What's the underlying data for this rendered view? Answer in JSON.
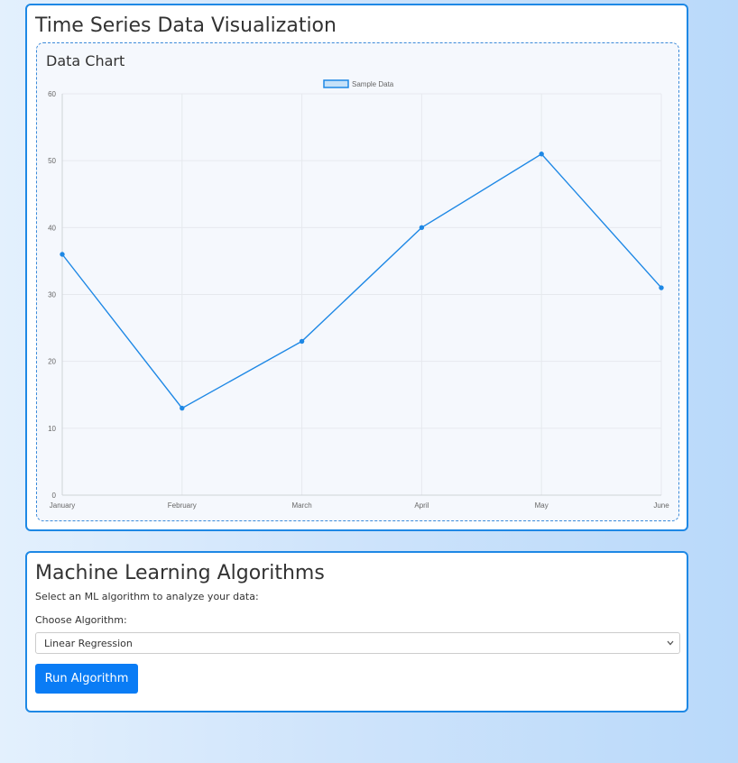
{
  "viz": {
    "title": "Time Series Data Visualization",
    "chart_title": "Data Chart"
  },
  "chart_data": {
    "type": "line",
    "categories": [
      "January",
      "February",
      "March",
      "April",
      "May",
      "June"
    ],
    "series": [
      {
        "name": "Sample Data",
        "values": [
          36,
          13,
          23,
          40,
          51,
          31
        ]
      }
    ],
    "ylim": [
      0,
      60
    ],
    "yticks": [
      0,
      10,
      20,
      30,
      40,
      50,
      60
    ],
    "grid": true,
    "legend": "top-center",
    "colors": {
      "line": "#1e88e5",
      "fill": "#c6e1f8"
    }
  },
  "ml": {
    "title": "Machine Learning Algorithms",
    "description": "Select an ML algorithm to analyze your data:",
    "choose_label": "Choose Algorithm:",
    "selected_algorithm": "Linear Regression",
    "run_button": "Run Algorithm"
  }
}
